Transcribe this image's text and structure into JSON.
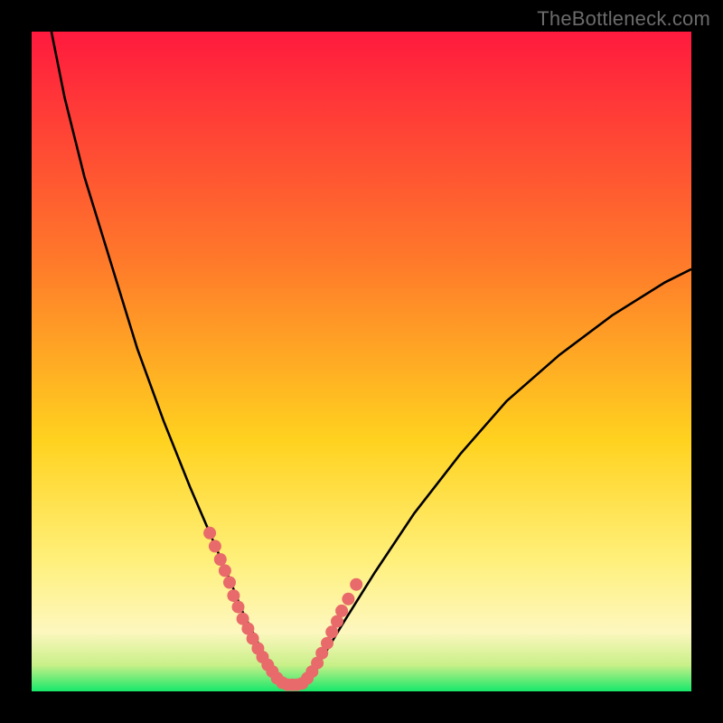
{
  "watermark": "TheBottleneck.com",
  "chart_data": {
    "type": "line",
    "title": "",
    "xlabel": "",
    "ylabel": "",
    "xlim": [
      0,
      100
    ],
    "ylim": [
      0,
      100
    ],
    "series": [
      {
        "name": "bottleneck-curve",
        "x": [
          3,
          5,
          8,
          12,
          16,
          20,
          24,
          27,
          30,
          32,
          34,
          35,
          36,
          37,
          38,
          39,
          40,
          42,
          44,
          47,
          52,
          58,
          65,
          72,
          80,
          88,
          96,
          100
        ],
        "y": [
          100,
          90,
          78,
          65,
          52,
          41,
          31,
          24,
          17,
          12,
          8,
          6,
          4,
          2,
          1,
          1,
          1,
          2,
          5,
          10,
          18,
          27,
          36,
          44,
          51,
          57,
          62,
          64
        ]
      }
    ],
    "markers": {
      "name": "cluster-dots",
      "x": [
        27.0,
        27.8,
        28.6,
        29.3,
        30.0,
        30.6,
        31.3,
        32.0,
        32.8,
        33.5,
        34.3,
        35.0,
        35.8,
        36.5,
        37.2,
        38.0,
        38.8,
        39.5,
        40.2,
        41.0,
        41.8,
        42.5,
        43.3,
        44.0,
        44.8,
        45.5,
        46.3,
        47.0,
        48.0,
        49.2
      ],
      "y": [
        24.0,
        22.0,
        20.0,
        18.3,
        16.5,
        14.5,
        12.8,
        11.0,
        9.5,
        8.0,
        6.5,
        5.2,
        4.0,
        3.0,
        2.0,
        1.3,
        1.0,
        1.0,
        1.0,
        1.2,
        2.0,
        3.0,
        4.3,
        5.8,
        7.3,
        9.0,
        10.6,
        12.2,
        14.0,
        16.2
      ]
    },
    "gradient_stops": [
      {
        "offset": 0,
        "color": "#ff1a3e"
      },
      {
        "offset": 35,
        "color": "#ff7a2a"
      },
      {
        "offset": 62,
        "color": "#ffd21f"
      },
      {
        "offset": 80,
        "color": "#fff07a"
      },
      {
        "offset": 91,
        "color": "#fdf7bf"
      },
      {
        "offset": 96,
        "color": "#c9f089"
      },
      {
        "offset": 100,
        "color": "#17e86a"
      }
    ],
    "marker_color": "#e86a6a",
    "curve_color": "#000000"
  }
}
